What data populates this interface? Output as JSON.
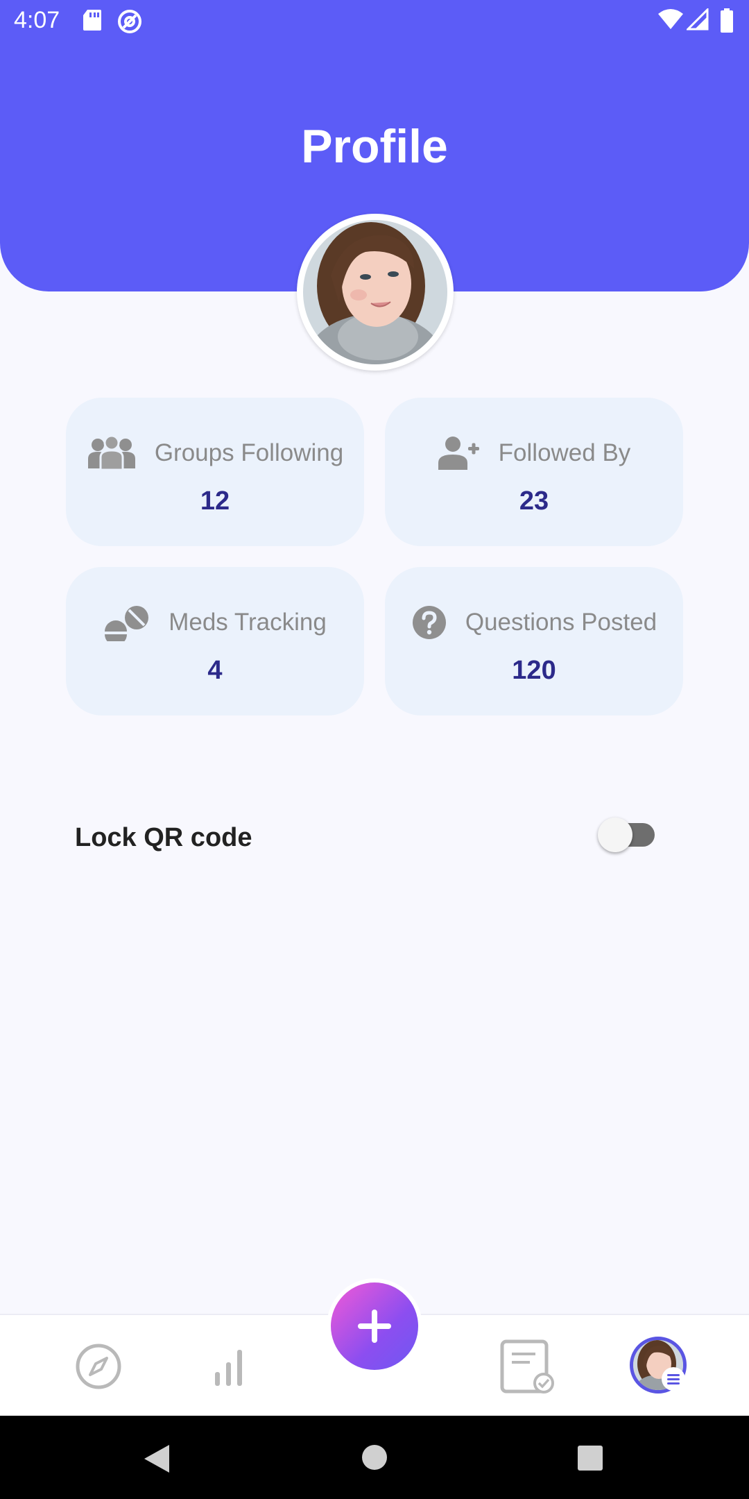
{
  "status_bar": {
    "time": "4:07"
  },
  "header": {
    "title": "Profile"
  },
  "stats": [
    {
      "label": "Groups Following",
      "value": "12",
      "icon": "groups-icon"
    },
    {
      "label": "Followed By",
      "value": "23",
      "icon": "person-add-icon"
    },
    {
      "label": "Meds Tracking",
      "value": "4",
      "icon": "pills-icon"
    },
    {
      "label": "Questions Posted",
      "value": "120",
      "icon": "question-icon"
    }
  ],
  "settings": {
    "lock_qr_label": "Lock QR code",
    "lock_qr_enabled": false
  },
  "bottom_nav": {
    "items": [
      "explore-icon",
      "stats-icon",
      "add-icon",
      "tasks-icon",
      "profile-avatar"
    ],
    "active": "profile-avatar"
  },
  "colors": {
    "header": "#5c5cf7",
    "card_bg": "#ebf2fc",
    "stat_value": "#2c2a8a",
    "fab_gradient_start": "#f25ad6",
    "fab_gradient_end": "#6f58f2"
  }
}
